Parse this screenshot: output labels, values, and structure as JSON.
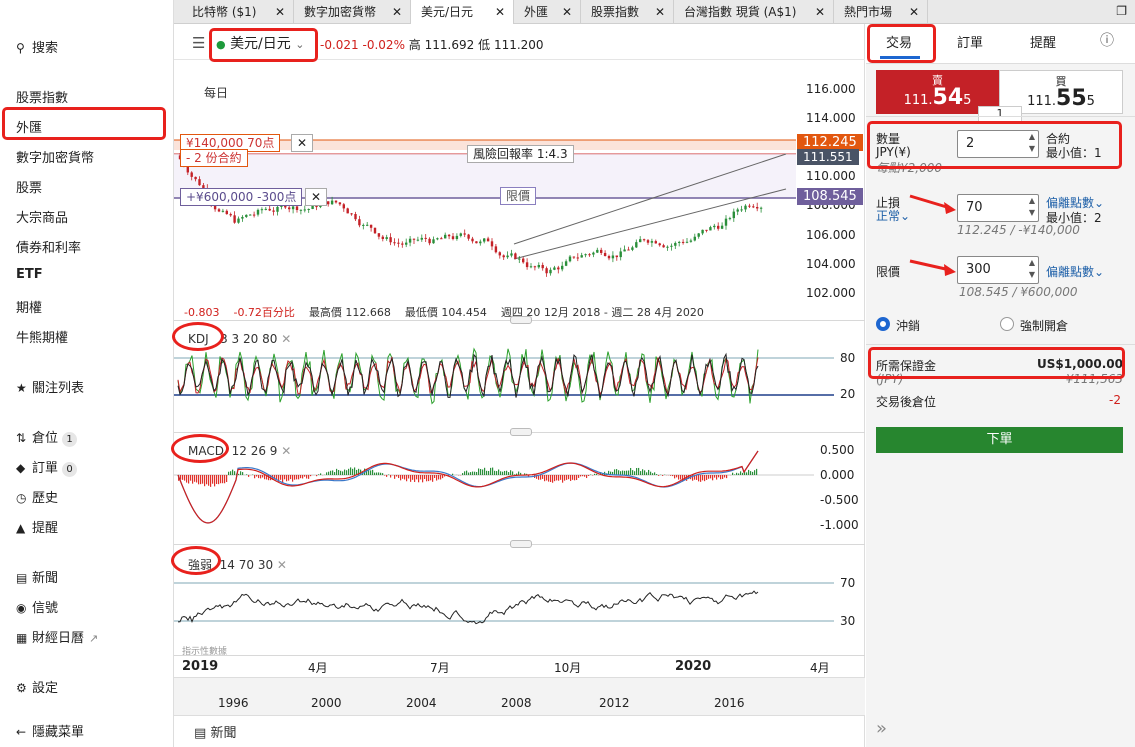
{
  "sidebar": {
    "search": "搜索",
    "menu": [
      "股票指數",
      "外匯",
      "數字加密貨幣",
      "股票",
      "大宗商品",
      "債券和利率",
      "ETF",
      "期權",
      "牛熊期權"
    ],
    "watchlist": "關注列表",
    "positions": "倉位",
    "positions_count": "1",
    "orders": "訂單",
    "orders_count": "0",
    "history": "歷史",
    "alerts": "提醒",
    "news": "新聞",
    "signals": "信號",
    "calendar": "財經日曆",
    "settings": "設定",
    "hide_menu": "隱藏菜單"
  },
  "tabs": [
    {
      "label": "比特幣 ($1)"
    },
    {
      "label": "數字加密貨幣"
    },
    {
      "label": "美元/日元"
    },
    {
      "label": "外匯"
    },
    {
      "label": "股票指數"
    },
    {
      "label": "台灣指數 現貨 (A$1)"
    },
    {
      "label": "熱門市場"
    }
  ],
  "header": {
    "instrument": "美元/日元",
    "change": "-0.021",
    "change_pct": "-0.02%",
    "high_label": "高",
    "high": "111.692",
    "low_label": "低",
    "low": "111.200",
    "period": "每日",
    "stop_tag": "¥140,000 70点",
    "contracts_tag": "- 2 份合約",
    "risk_reward": "風險回報率 1:4.3",
    "limit_box": "限價",
    "limit_tag": "+¥600,000 -300点",
    "price_now": "112.245",
    "price_cur2": "111.551",
    "price_limit": "108.545",
    "stats_change": "-0.803",
    "stats_pct": "-0.72百分比",
    "stats_high": "最高價 112.668",
    "stats_low": "最低價 104.454",
    "stats_range": "週四 20 12月 2018 - 週二 28 4月 2020",
    "price_ticks": [
      "116.000",
      "114.000",
      "110.000",
      "108.000",
      "106.000",
      "104.000",
      "102.000"
    ],
    "kdj": "KDJ",
    "kdj_params": "3 3 20 80",
    "kdj_levels": [
      "80",
      "20"
    ],
    "macd": "MACD",
    "macd_params": "12 26 9",
    "macd_ticks": [
      "0.500",
      "0.000",
      "-0.500",
      "-1.000"
    ],
    "rsi": "強弱",
    "rsi_params": "14 70 30",
    "rsi_levels": [
      "70",
      "30"
    ],
    "attribution": "指示性數據",
    "xaxis": [
      "2019",
      "4月",
      "7月",
      "10月",
      "2020",
      "4月"
    ],
    "nav_years": [
      "1996",
      "2000",
      "2004",
      "2008",
      "2012",
      "2016"
    ],
    "news": "新聞"
  },
  "trade": {
    "tab_trade": "交易",
    "tab_orders": "訂單",
    "tab_alerts": "提醒",
    "sell_label": "賣",
    "sell_big": "111.",
    "sell_digits": "54",
    "sell_small": "5",
    "buy_label": "買",
    "buy_big": "111.",
    "buy_digits": "55",
    "buy_small": "5",
    "spread": "1",
    "qty_label": "數量",
    "qty_unit": "JPY(¥)",
    "qty_value": "2",
    "qty_contracts": "合約",
    "qty_min": "最小值：1",
    "qty_note": "每點¥2,000",
    "stop_label": "止損",
    "stop_type": "正常",
    "stop_value": "70",
    "stop_mode": "偏離點數",
    "stop_min": "最小值：2",
    "stop_note": "112.245 / -¥140,000",
    "limit_label": "限價",
    "limit_value": "300",
    "limit_mode": "偏離點數",
    "limit_note": "108.545 / ¥600,000",
    "hedge": "沖銷",
    "force_open": "強制開倉",
    "margin_label": "所需保證金",
    "margin_value": "US$1,000.00",
    "margin_jpy": "(JPY)",
    "margin_jpy_value": "¥111,563",
    "after_label": "交易後倉位",
    "after_value": "-2",
    "submit": "下單"
  },
  "colors": {
    "sell": "#c42127",
    "submit": "#27862f",
    "price_tag": "#e2570f",
    "limit_tag": "#6f5f9c",
    "accent": "#1d66d0"
  }
}
